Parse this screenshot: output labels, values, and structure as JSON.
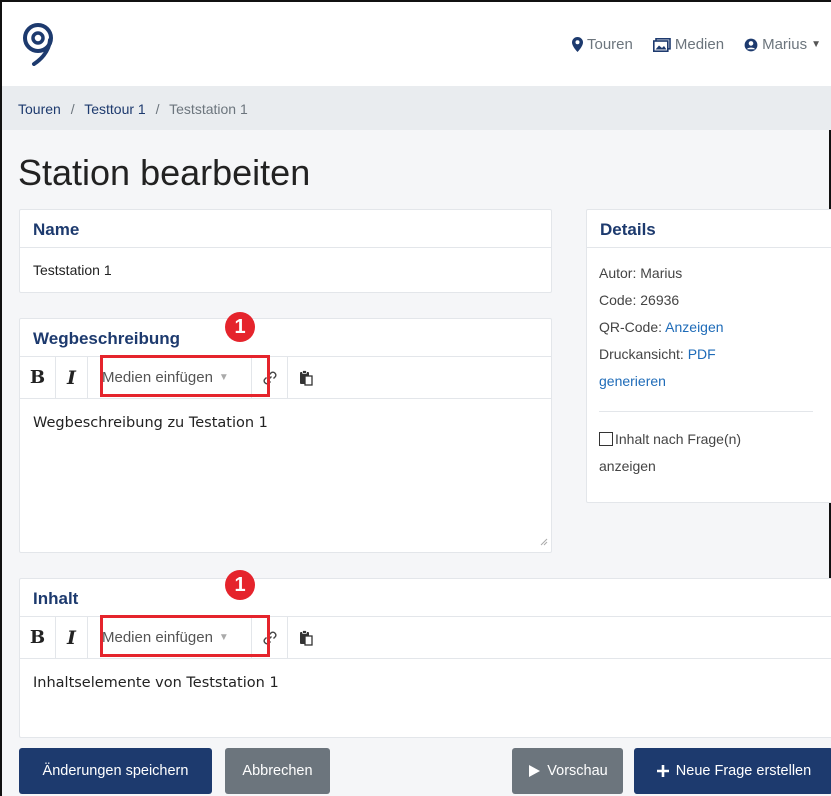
{
  "nav": {
    "tours_label": "Touren",
    "media_label": "Medien",
    "user_label": "Marius"
  },
  "breadcrumb": {
    "items": [
      "Touren",
      "Testtour 1",
      "Teststation 1"
    ],
    "separator": "/"
  },
  "page_title": "Station bearbeiten",
  "name_card": {
    "header": "Name",
    "value": "Teststation 1"
  },
  "details": {
    "header": "Details",
    "author_label": "Autor: Marius",
    "code_label": "Code: 26936",
    "qr_label": "QR-Code:",
    "qr_link": "Anzeigen",
    "print_label": "Druckansicht:",
    "print_link_1": "PDF",
    "print_link_2": "generieren",
    "checkbox_label_1": "Inhalt nach Frage(n)",
    "checkbox_label_2": "anzeigen",
    "checkbox_checked": false
  },
  "wegbeschreibung": {
    "header": "Wegbeschreibung",
    "toolbar": {
      "bold": "B",
      "italic": "I",
      "media_label": "Medien einfügen"
    },
    "content": "Wegbeschreibung zu Testation 1"
  },
  "inhalt": {
    "header": "Inhalt",
    "toolbar": {
      "bold": "B",
      "italic": "I",
      "media_label": "Medien einfügen"
    },
    "content": "Inhaltselemente von Teststation 1"
  },
  "annotations": {
    "marker_1": "1",
    "marker_2": "1"
  },
  "footer": {
    "save_label": "Änderungen speichern",
    "cancel_label": "Abbrechen",
    "preview_label": "Vorschau",
    "new_question_label": "Neue Frage erstellen"
  },
  "colors": {
    "primary": "#1d3a6e",
    "secondary": "#6c757d",
    "link": "#1e6bb8",
    "highlight": "#e5242c"
  }
}
